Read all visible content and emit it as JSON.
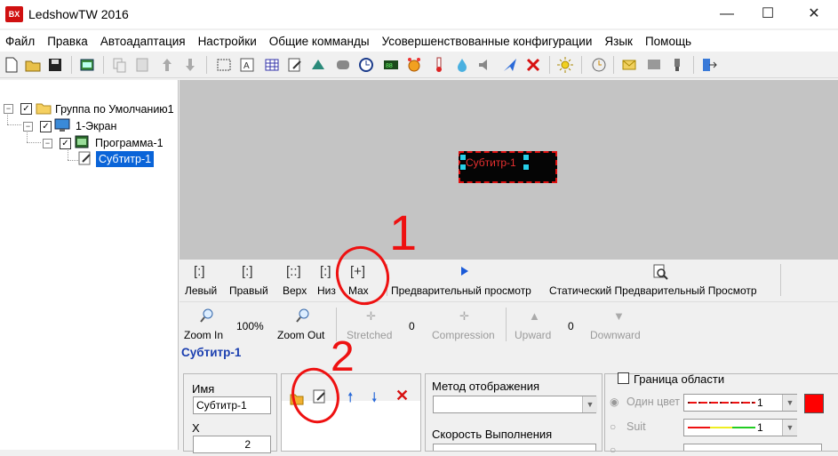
{
  "window": {
    "title": "LedshowTW 2016",
    "logo_text": "BX"
  },
  "menu": [
    "Файл",
    "Правка",
    "Автоадаптация",
    "Настройки",
    "Общие комманды",
    "Усовершенствованные конфигурации",
    "Язык",
    "Помощь"
  ],
  "tree": {
    "group": "Группа по Умолчанию1",
    "screen": "1-Экран",
    "program": "Программа-1",
    "subtitle": "Субтитр-1"
  },
  "preview": {
    "led_text": "Субтитр-1"
  },
  "position_tools": {
    "left": "Левый",
    "right": "Правый",
    "top": "Верх",
    "bottom": "Низ",
    "max": "Max",
    "preview": "Предварительный просмотр",
    "static_preview": "Статический Предварительный Просмотр"
  },
  "zoom_tools": {
    "zoom_in": "Zoom In",
    "zoom_value": "100%",
    "zoom_out": "Zoom Out",
    "stretched": "Stretched",
    "stretched_value": "0",
    "compression": "Compression",
    "upward": "Upward",
    "upward_value": "0",
    "downward": "Downward"
  },
  "properties": {
    "title": "Субтитр-1",
    "name_label": "Имя",
    "name_value": "Субтитр-1",
    "x_label": "X",
    "x_value": "2",
    "display_method_label": "Метод отображения",
    "display_method_value": "",
    "speed_label": "Скорость Выполнения",
    "border_label": "Граница области",
    "single_color_label": "Один цвет",
    "single_color_value": "1",
    "suit_label": "Suit",
    "suit_value": "1"
  },
  "annotations": {
    "one": "1",
    "two": "2"
  },
  "colors": {
    "accent": "#1b3fb0",
    "annotation": "#e11",
    "border_color": "#ff0000"
  }
}
